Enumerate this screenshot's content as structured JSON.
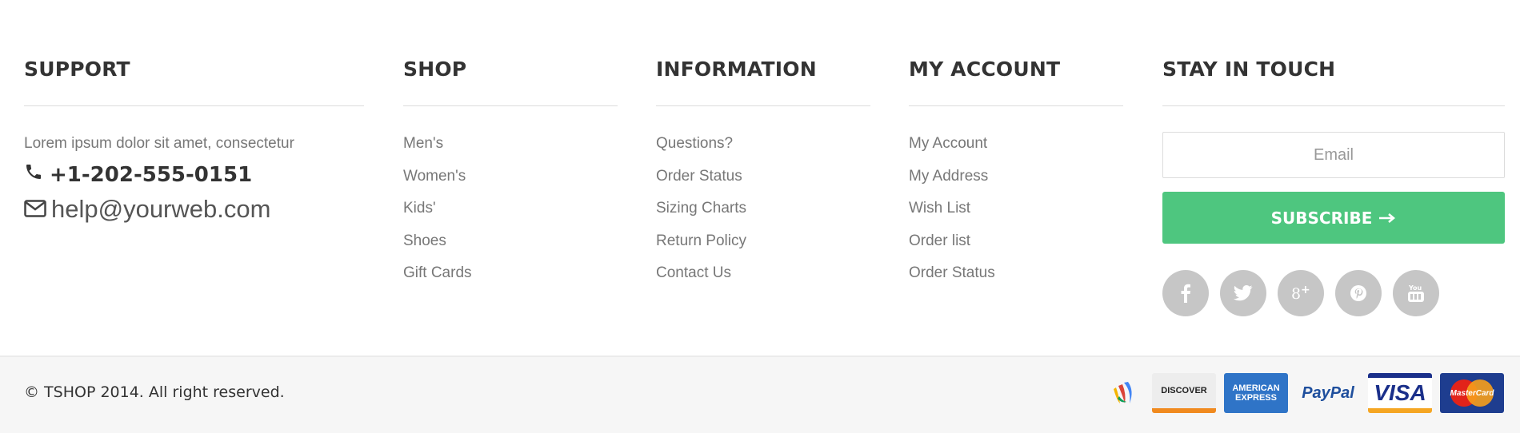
{
  "support": {
    "title": "SUPPORT",
    "text": "Lorem ipsum dolor sit amet, consectetur",
    "phone": "+1-202-555-0151",
    "email": "help@yourweb.com"
  },
  "shop": {
    "title": "SHOP",
    "items": [
      "Men's",
      "Women's",
      "Kids'",
      "Shoes",
      "Gift Cards"
    ]
  },
  "information": {
    "title": "INFORMATION",
    "items": [
      "Questions?",
      "Order Status",
      "Sizing Charts",
      "Return Policy",
      "Contact Us"
    ]
  },
  "account": {
    "title": "MY ACCOUNT",
    "items": [
      "My Account",
      "My Address",
      "Wish List",
      "Order list",
      "Order Status"
    ]
  },
  "touch": {
    "title": "STAY IN TOUCH",
    "email_placeholder": "Email",
    "subscribe_label": "SUBSCRIBE",
    "socials": [
      "facebook-icon",
      "twitter-icon",
      "google-plus-icon",
      "pinterest-icon",
      "youtube-icon"
    ]
  },
  "bottom": {
    "copyright": "© TSHOP 2014. All right reserved.",
    "payments": [
      "google-wallet-icon",
      "discover-icon",
      "american-express-icon",
      "paypal-icon",
      "visa-icon",
      "mastercard-icon"
    ],
    "payment_labels": {
      "discover": "DISCOVER",
      "amex_line1": "AMERICAN",
      "amex_line2": "EXPRESS",
      "paypal": "PayPal",
      "visa": "VISA",
      "mastercard": "MasterCard"
    }
  },
  "colors": {
    "accent": "#4ec67f",
    "social": "#c6c6c6",
    "muted_text": "#777777"
  }
}
